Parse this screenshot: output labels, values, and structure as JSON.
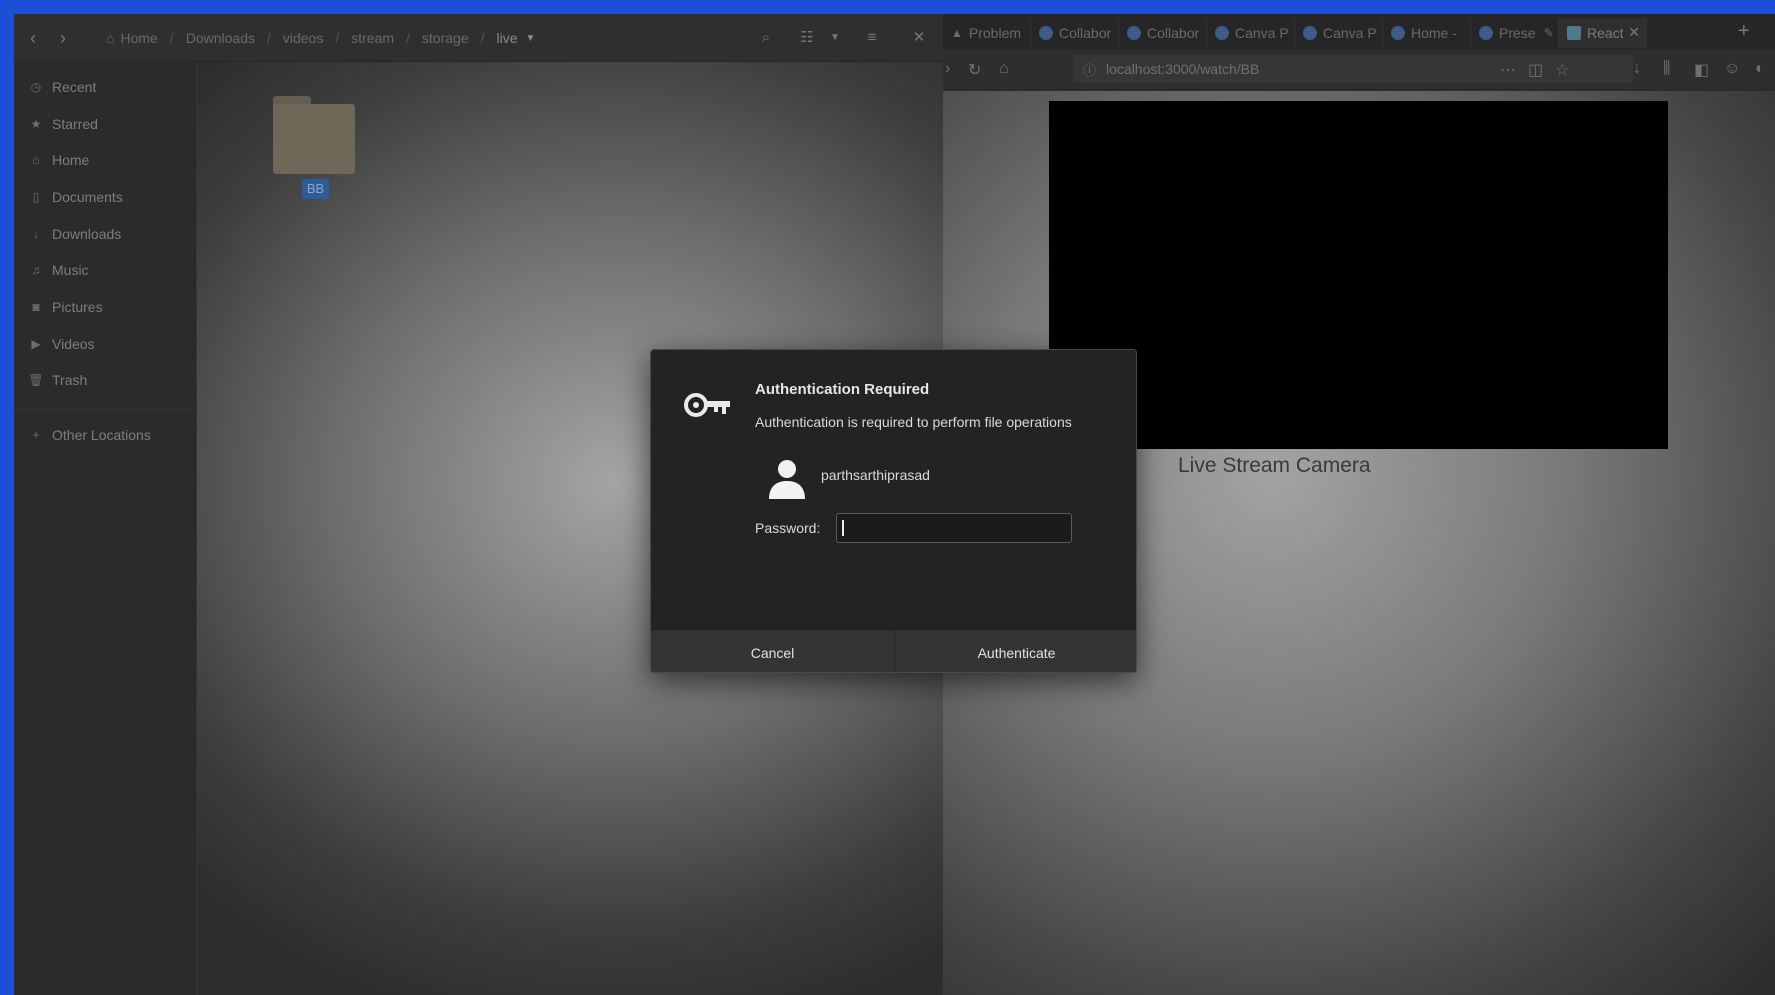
{
  "file_manager": {
    "breadcrumbs": [
      "Home",
      "Downloads",
      "videos",
      "stream",
      "storage",
      "live"
    ],
    "sidebar": [
      {
        "label": "Recent",
        "icon": "clock-icon"
      },
      {
        "label": "Starred",
        "icon": "star-icon"
      },
      {
        "label": "Home",
        "icon": "home-icon"
      },
      {
        "label": "Documents",
        "icon": "document-icon"
      },
      {
        "label": "Downloads",
        "icon": "download-icon"
      },
      {
        "label": "Music",
        "icon": "music-icon"
      },
      {
        "label": "Pictures",
        "icon": "camera-icon"
      },
      {
        "label": "Videos",
        "icon": "video-icon"
      },
      {
        "label": "Trash",
        "icon": "trash-icon"
      }
    ],
    "other_locations": "Other Locations",
    "folder": {
      "label": "BB"
    }
  },
  "browser": {
    "tabs": [
      {
        "label": "Problem"
      },
      {
        "label": "Collabor"
      },
      {
        "label": "Collabor"
      },
      {
        "label": "Canva P"
      },
      {
        "label": "Canva P"
      },
      {
        "label": "Home - "
      },
      {
        "label": "Prese"
      },
      {
        "label": "React"
      }
    ],
    "url": "localhost:3000/watch/BB",
    "page_heading": "Live Stream Camera"
  },
  "dialog": {
    "title": "Authentication Required",
    "message": "Authentication is required to perform file operations",
    "username": "parthsarthiprasad",
    "password_label": "Password:",
    "password_value": "",
    "cancel_label": "Cancel",
    "authenticate_label": "Authenticate"
  },
  "colors": {
    "desktop_accent": "#1b4fd8",
    "dialog_bg": "#232323",
    "folder_label_bg": "#2e5c9a"
  }
}
